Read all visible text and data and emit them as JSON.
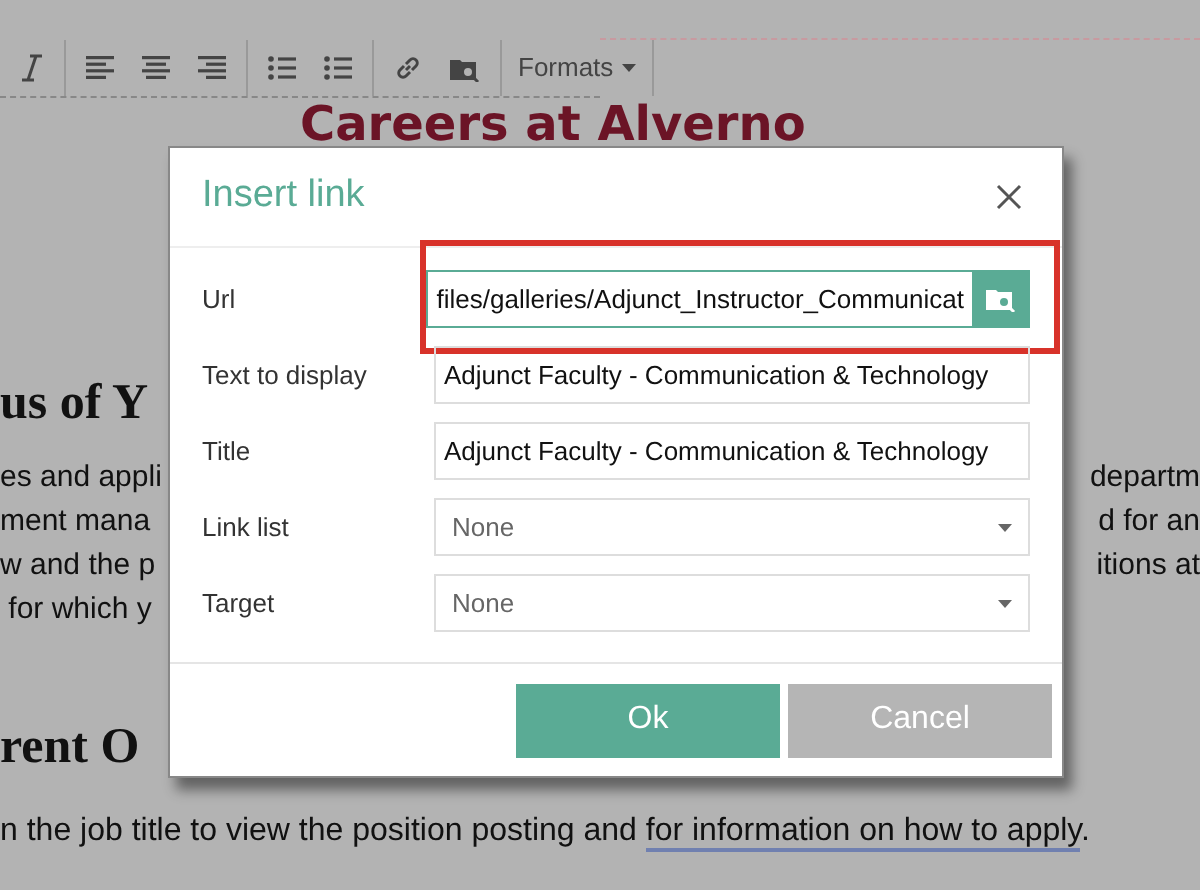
{
  "toolbar": {
    "formats": "Formats"
  },
  "page": {
    "heading": "Careers at Alverno",
    "rows": [
      {
        "kind": "heading",
        "left": "us of Y",
        "right": ""
      },
      {
        "kind": "text",
        "left": "es and appli",
        "right": "departm"
      },
      {
        "kind": "text",
        "left": "ment mana",
        "right": "d for an"
      },
      {
        "kind": "text",
        "left": "w and the p",
        "right": "itions at"
      },
      {
        "kind": "text",
        "left": " for which y",
        "right": ""
      },
      {
        "kind": "heading",
        "left": "rent O",
        "right": ""
      }
    ],
    "last_line": {
      "text": "n the job title to view the position posting and ",
      "link": "for information on how to apply",
      "end": "."
    }
  },
  "dialog": {
    "title": "Insert link",
    "fields": [
      {
        "kind": "url",
        "label": "Url",
        "value": "files/galleries/Adjunct_Instructor_Communicat",
        "highlighted": true
      },
      {
        "kind": "text",
        "label": "Text to display",
        "value": "Adjunct Faculty - Communication & Technology"
      },
      {
        "kind": "text",
        "label": "Title",
        "value": "Adjunct Faculty - Communication & Technology"
      },
      {
        "kind": "select",
        "label": "Link list",
        "value": "None"
      },
      {
        "kind": "select",
        "label": "Target",
        "value": "None"
      }
    ],
    "buttons": [
      {
        "kind": "primary",
        "label": "Ok"
      },
      {
        "kind": "secondary",
        "label": "Cancel"
      }
    ]
  }
}
